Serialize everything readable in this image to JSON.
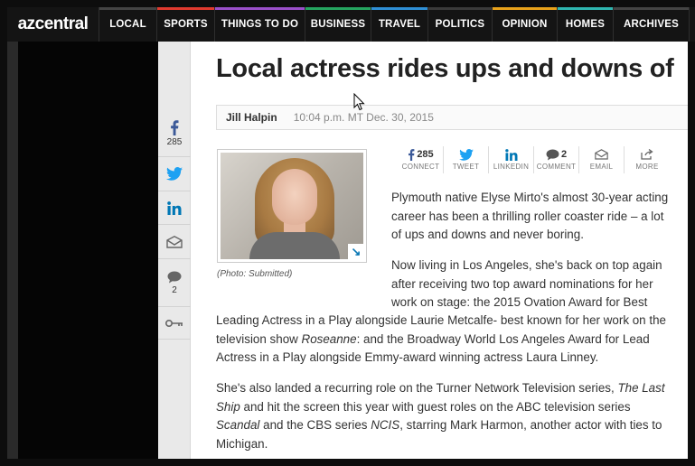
{
  "nav": {
    "logo": "azcentral",
    "items": [
      {
        "label": "LOCAL",
        "color": "#444444"
      },
      {
        "label": "SPORTS",
        "color": "#e03a2f"
      },
      {
        "label": "THINGS TO DO",
        "color": "#9a4fc9"
      },
      {
        "label": "BUSINESS",
        "color": "#25a55f"
      },
      {
        "label": "TRAVEL",
        "color": "#2f8fd6"
      },
      {
        "label": "POLITICS",
        "color": "#3a3a3a"
      },
      {
        "label": "OPINION",
        "color": "#e8a21b"
      },
      {
        "label": "HOMES",
        "color": "#2fb6b0"
      },
      {
        "label": "ARCHIVES",
        "color": "#444444"
      }
    ]
  },
  "rail": {
    "facebook_count": "285",
    "comments_count": "2"
  },
  "article": {
    "headline": "Local actress rides ups and downs of",
    "author": "Jill Halpin",
    "timestamp": "10:04 p.m. MT Dec. 30, 2015",
    "photo_caption": "(Photo: Submitted)",
    "share": {
      "connect_count": "285",
      "connect_label": "CONNECT",
      "tweet_label": "TWEET",
      "linkedin_label": "LINKEDIN",
      "comment_count": "2",
      "comment_label": "COMMENT",
      "email_label": "EMAIL",
      "more_label": "MORE"
    },
    "p1_lines": [
      "Plymouth native Elyse Mirto's almost 30-year acting",
      "career has been a thrilling roller coaster ride – a lot",
      "of ups and downs and never boring."
    ],
    "p2_lines": [
      "Now living in Los Angeles, she's back on top again",
      "after receiving two top award nominations for her",
      "work on stage: the 2015 Ovation Award for Best"
    ],
    "p2_full": {
      "l4": "Leading Actress in a Play alongside Laurie Metcalfe- best known for her work on the",
      "l5_a": "television show ",
      "l5_em": "Roseanne",
      "l5_b": ": and the Broadway World Los Angeles Award for Lead",
      "l6": "Actress in a Play alongside Emmy-award winning actress Laura Linney."
    },
    "p3": {
      "l1_a": "She's also landed a recurring role on the Turner Network Television series, ",
      "l1_em": "The Last",
      "l2_em": "Ship",
      "l2_b": " and hit the screen this year with guest roles on the ABC television series",
      "l3_em1": "Scandal",
      "l3_b": " and the CBS series ",
      "l3_em2": "NCIS",
      "l3_c": ", starring Mark Harmon, another actor with ties to",
      "l4": "Michigan."
    }
  }
}
